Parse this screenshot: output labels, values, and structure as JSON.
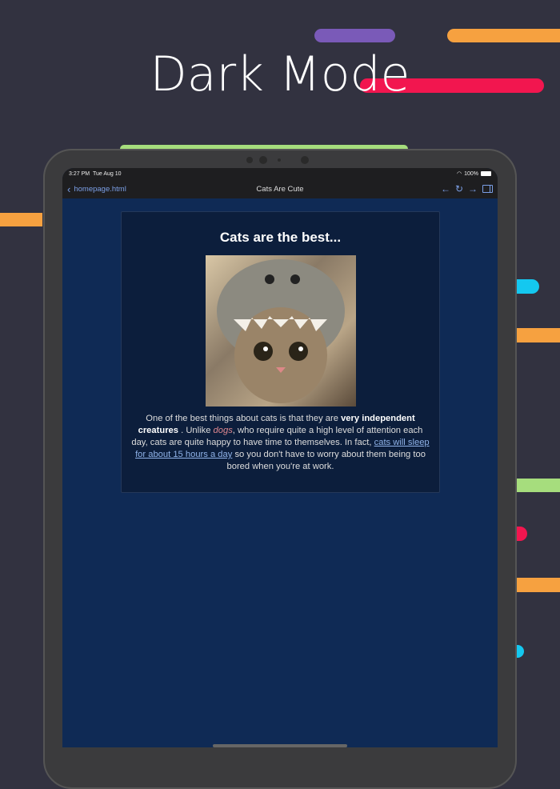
{
  "headline": "Dark Mode",
  "colors": {
    "purple": "#7a5ab8",
    "orange": "#f6a140",
    "red": "#f2164f",
    "green": "#a6dd7d",
    "cyan": "#14c8f0"
  },
  "status": {
    "time": "3:27 PM",
    "date": "Tue Aug 10",
    "battery": "100%"
  },
  "nav": {
    "back_label": "homepage.html",
    "title": "Cats Are Cute"
  },
  "article": {
    "heading": "Cats are the best...",
    "image_alt": "cat wearing a shark hat",
    "p1": "One of the best things about cats is that they are ",
    "bold": "very independent creatures",
    "p2": " . Unlike ",
    "italic": "dogs",
    "p3": ", who require quite a high level of attention each day, cats are quite happy to have time to themselves. In fact, ",
    "link": "cats will sleep for about 15 hours a day",
    "p4": " so you don't have to worry about them being too bored when you're at work."
  }
}
